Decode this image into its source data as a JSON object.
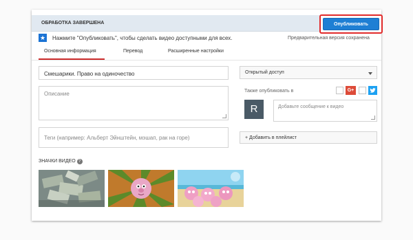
{
  "status": {
    "title": "ОБРАБОТКА ЗАВЕРШЕНА",
    "publish_label": "Опубликовать"
  },
  "info": {
    "icon": "star-icon",
    "message": "Нажмите \"Опубликовать\", чтобы сделать видео доступными для всех.",
    "preview_status": "Предварительная версия сохранена"
  },
  "tabs": [
    {
      "label": "Основная информация",
      "active": true
    },
    {
      "label": "Перевод",
      "active": false
    },
    {
      "label": "Расширенные настройки",
      "active": false
    }
  ],
  "form": {
    "title_value": "Смешарики. Право на одиночество",
    "description_placeholder": "Описание",
    "tags_placeholder": "Теги (например: Альберт Эйнштейн, мэшап, рак на горе)"
  },
  "sidebar": {
    "privacy_value": "Открытый доступ",
    "also_publish_label": "Также опубликовать в",
    "gplus_label": "G+",
    "avatar_letter": "R",
    "message_placeholder": "Добавьте сообщение к видео",
    "playlist_label": "+ Добавить в плейлист"
  },
  "thumbnails": {
    "label": "ЗНАЧКИ ВИДЕО",
    "help_icon": "?"
  },
  "colors": {
    "publish": "#1e7fd4",
    "highlight": "#e12a2a",
    "active_tab": "#cc2b2b"
  }
}
